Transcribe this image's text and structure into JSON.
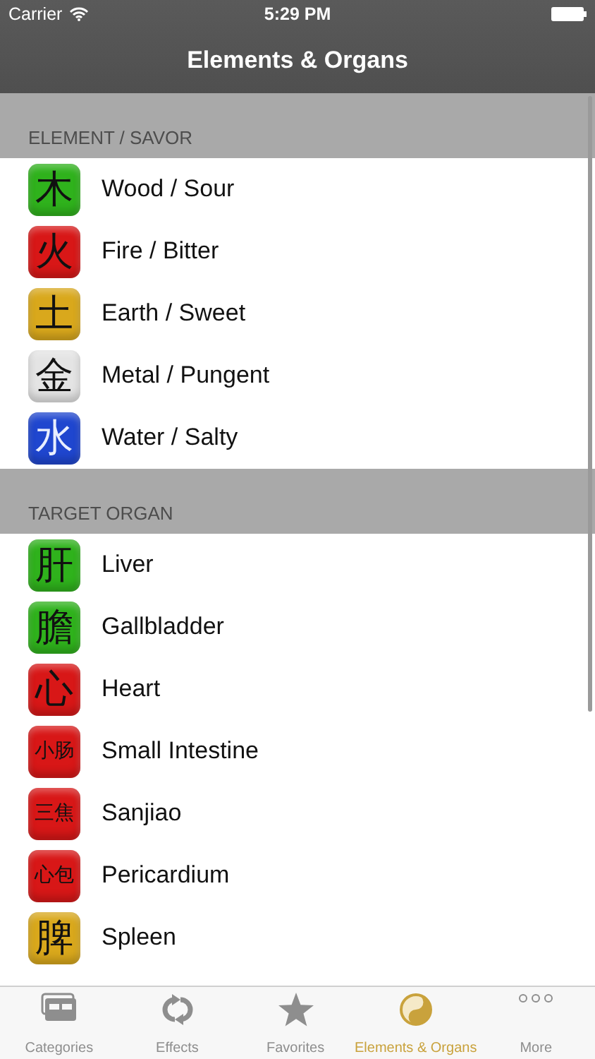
{
  "status_bar": {
    "carrier": "Carrier",
    "time": "5:29 PM"
  },
  "nav_bar": {
    "title": "Elements & Organs"
  },
  "sections": [
    {
      "header": "ELEMENT / SAVOR",
      "rows": [
        {
          "glyph": "木",
          "label": "Wood / Sour",
          "color": "#2fb21c"
        },
        {
          "glyph": "火",
          "label": "Fire / Bitter",
          "color": "#d81717"
        },
        {
          "glyph": "土",
          "label": "Earth / Sweet",
          "color": "#d9a81c"
        },
        {
          "glyph": "金",
          "label": "Metal / Pungent",
          "color": "#e4e4e4"
        },
        {
          "glyph": "水",
          "label": "Water / Salty",
          "color": "#1f46cf"
        }
      ]
    },
    {
      "header": "TARGET ORGAN",
      "rows": [
        {
          "glyph": "肝",
          "label": "Liver",
          "color": "#2fb21c"
        },
        {
          "glyph": "膽",
          "label": "Gallbladder",
          "color": "#2fb21c"
        },
        {
          "glyph": "心",
          "label": "Heart",
          "color": "#d81717"
        },
        {
          "glyph": "小肠",
          "label": "Small Intestine",
          "color": "#d81717"
        },
        {
          "glyph": "三焦",
          "label": "Sanjiao",
          "color": "#d81717"
        },
        {
          "glyph": "心包",
          "label": "Pericardium",
          "color": "#d81717"
        },
        {
          "glyph": "脾",
          "label": "Spleen",
          "color": "#d9a81c"
        }
      ]
    }
  ],
  "tab_bar": [
    {
      "kind": "categories",
      "label": "Categories",
      "selected": false
    },
    {
      "kind": "effects",
      "label": "Effects",
      "selected": false
    },
    {
      "kind": "favorites",
      "label": "Favorites",
      "selected": false
    },
    {
      "kind": "yinyang",
      "label": "Elements & Organs",
      "selected": true
    },
    {
      "kind": "more",
      "label": "More",
      "selected": false
    }
  ]
}
